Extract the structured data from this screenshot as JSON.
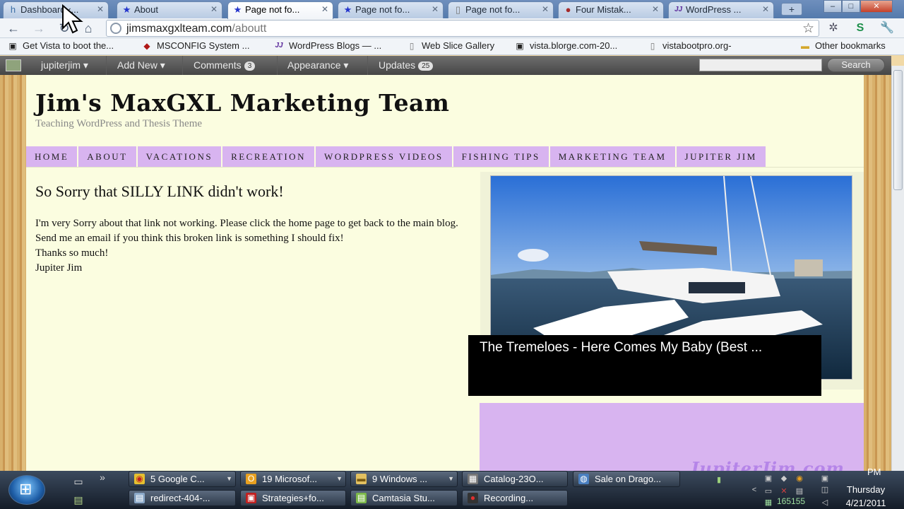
{
  "tabs": [
    {
      "label": "Dashboard ‹...",
      "icon": "wordpress-icon",
      "active": false
    },
    {
      "label": "About",
      "icon": "star-icon",
      "active": false
    },
    {
      "label": "Page not fo...",
      "icon": "star-icon",
      "active": true
    },
    {
      "label": "Page not fo...",
      "icon": "star-icon",
      "active": false
    },
    {
      "label": "Page not fo...",
      "icon": "page-icon",
      "active": false
    },
    {
      "label": "Four Mistak...",
      "icon": "ball-icon",
      "active": false
    },
    {
      "label": "WordPress ...",
      "icon": "jj-icon",
      "active": false
    }
  ],
  "window_controls": {
    "minimize": "–",
    "maximize": "□",
    "close": "✕"
  },
  "address_bar": {
    "domain": "jimsmaxgxlteam.com",
    "path": "/aboutt"
  },
  "bookmarks": [
    {
      "label": "Get Vista to boot the...",
      "icon": "page-icon"
    },
    {
      "label": "MSCONFIG System ...",
      "icon": "diamond-icon"
    },
    {
      "label": "WordPress Blogs — ...",
      "icon": "jj-icon"
    },
    {
      "label": "Web Slice Gallery",
      "icon": "page-icon"
    },
    {
      "label": "vista.blorge.com-20...",
      "icon": "page-icon"
    },
    {
      "label": "vistabootpro.org-",
      "icon": "page-icon"
    },
    {
      "label": "Other bookmarks",
      "icon": "folder-icon"
    }
  ],
  "admin_bar": {
    "user": "jupiterjim ▾",
    "add_new": "Add New ▾",
    "comments": "Comments",
    "comments_count": "3",
    "appearance": "Appearance ▾",
    "updates": "Updates",
    "updates_count": "25",
    "search_button": "Search"
  },
  "site": {
    "title": "Jim's MaxGXL Marketing Team",
    "tagline": "Teaching WordPress and Thesis Theme",
    "menu": [
      "HOME",
      "ABOUT",
      "VACATIONS",
      "RECREATION",
      "WORDPRESS VIDEOS",
      "FISHING TIPS",
      "MARKETING TEAM",
      "JUPITER JIM"
    ],
    "post_title": "So Sorry that SILLY LINK didn't work!",
    "post_body": [
      "I'm very Sorry about that link not working. Please click the home page to get back to the main blog. Send me an email if you think this broken link is something I should fix!",
      "Thanks so much!",
      "Jupiter Jim"
    ],
    "video_title": "The Tremeloes - Here Comes My Baby (Best ..."
  },
  "taskbar": {
    "row1": [
      {
        "label": "5 Google C...",
        "icon": "chrome-icon"
      },
      {
        "label": "19 Microsof...",
        "icon": "outlook-icon"
      },
      {
        "label": "9 Windows ...",
        "icon": "folder-icon"
      },
      {
        "label": "Catalog-23O...",
        "icon": "app-icon"
      },
      {
        "label": "Sale on Drago...",
        "icon": "globe-icon"
      }
    ],
    "row2": [
      {
        "label": "redirect-404-...",
        "icon": "document-icon"
      },
      {
        "label": "Strategies+fo...",
        "icon": "pdf-icon"
      },
      {
        "label": "Camtasia Stu...",
        "icon": "camtasia-icon"
      },
      {
        "label": "Recording...",
        "icon": "record-icon"
      }
    ],
    "clock_day": "Thursday",
    "clock_date": "4/21/2011",
    "clock_time": "PM",
    "counter": "165155"
  },
  "watermark": "JupiterJim.com"
}
